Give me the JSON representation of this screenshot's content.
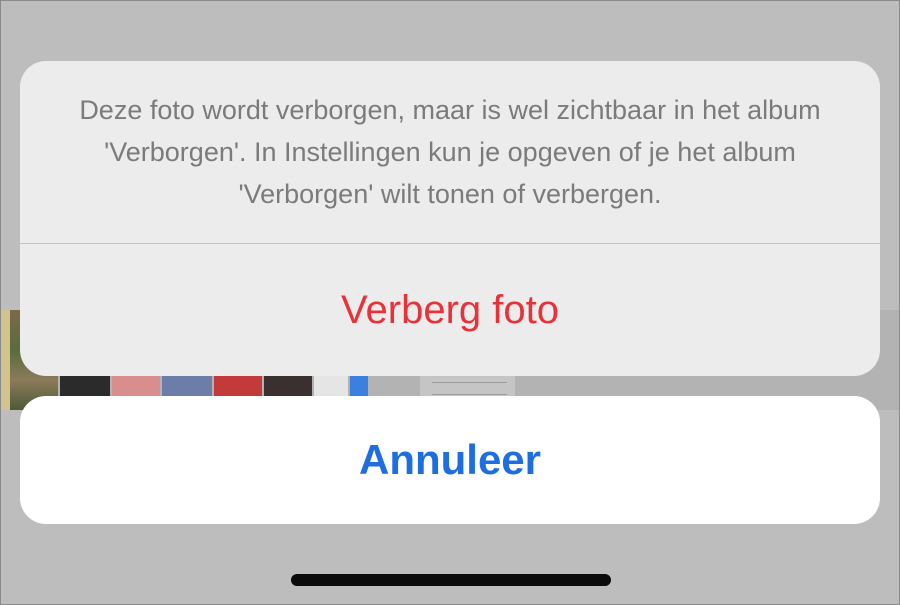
{
  "action_sheet": {
    "message": "Deze foto wordt verborgen, maar is wel zichtbaar in het album 'Verborgen'. In Instellingen kun je opgeven of je het album 'Verborgen' wilt tonen of verbergen.",
    "hide_button_label": "Verberg foto",
    "cancel_button_label": "Annuleer"
  },
  "colors": {
    "destructive": "#e8323a",
    "cancel": "#1f6ee0",
    "message_text": "#7b7b7b",
    "sheet_background": "#ececec",
    "cancel_background": "#ffffff"
  },
  "icons": {
    "home_indicator": "home-indicator-bar"
  }
}
